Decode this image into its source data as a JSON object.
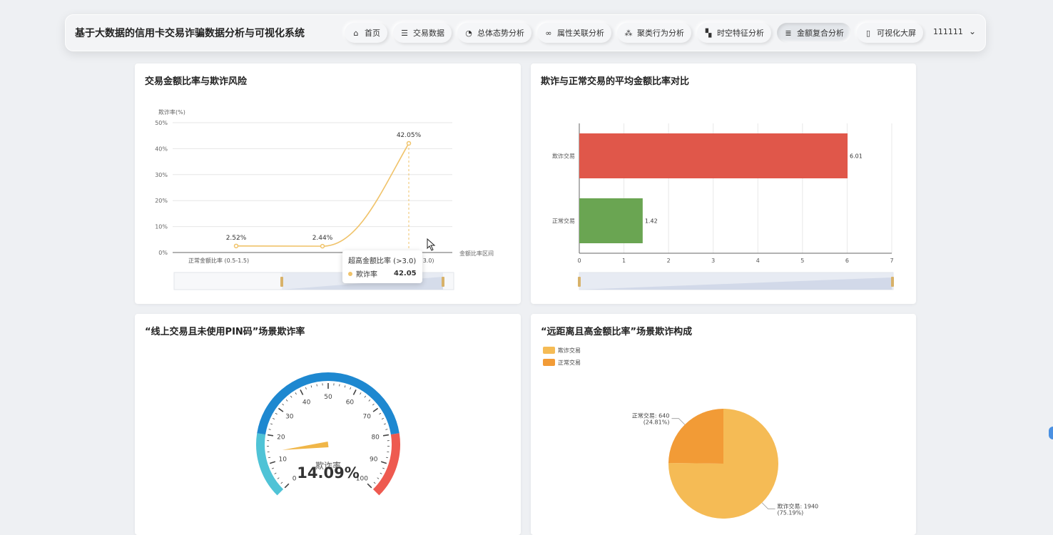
{
  "header": {
    "title": "基于大数据的信用卡交易诈骗数据分析与可视化系统",
    "nav": [
      {
        "label": "首页",
        "icon": "home-icon",
        "glyph": "⌂"
      },
      {
        "label": "交易数据",
        "icon": "database-icon",
        "glyph": "☰"
      },
      {
        "label": "总体态势分析",
        "icon": "pie-chart-icon",
        "glyph": "◔"
      },
      {
        "label": "属性关联分析",
        "icon": "link-icon",
        "glyph": "∞"
      },
      {
        "label": "聚类行为分析",
        "icon": "cluster-icon",
        "glyph": "⁂"
      },
      {
        "label": "时空特征分析",
        "icon": "map-icon",
        "glyph": "▚"
      },
      {
        "label": "金额复合分析",
        "icon": "coins-icon",
        "glyph": "≣"
      },
      {
        "label": "可视化大屏",
        "icon": "screen-icon",
        "glyph": "▯"
      }
    ],
    "active_nav": 6,
    "user": "111111",
    "user_caret": "⌄"
  },
  "panels": {
    "line": {
      "title": "交易金额比率与欺诈风险"
    },
    "bar": {
      "title": "欺诈与正常交易的平均金额比率对比"
    },
    "gauge": {
      "title": "“线上交易且未使用PIN码”场景欺诈率"
    },
    "pie": {
      "title": "“远距离且高金额比率”场景欺诈构成"
    }
  },
  "tooltip": {
    "title": "超高金额比率 (>3.0)",
    "series": "欺诈率",
    "value": "42.05"
  },
  "chart_data": [
    {
      "type": "line",
      "title": "交易金额比率与欺诈风险",
      "xlabel": "金额比率区间",
      "ylabel": "欺诈率(%)",
      "ylim": [
        0,
        50
      ],
      "yticks": [
        "0%",
        "10%",
        "20%",
        "30%",
        "40%",
        "50%"
      ],
      "categories": [
        "正常金额比率 (0.5-1.5)",
        "",
        "超高金额比率 (>3.0)"
      ],
      "visible_tick_labels": [
        "正常金额比率 (0.5-1.5)",
        ">3.0)"
      ],
      "series": [
        {
          "name": "欺诈率",
          "values": [
            2.52,
            2.44,
            42.05
          ],
          "labels": [
            "2.52%",
            "2.44%",
            "42.05%"
          ]
        }
      ],
      "color": "#f0c36a",
      "grid": true,
      "has_datazoom": true
    },
    {
      "type": "bar",
      "title": "欺诈与正常交易的平均金额比率对比",
      "orientation": "horizontal",
      "categories": [
        "欺诈交易",
        "正常交易"
      ],
      "values": [
        6.01,
        1.42
      ],
      "colors": [
        "#e0574a",
        "#6aa552"
      ],
      "xlim": [
        0,
        7
      ],
      "xticks": [
        "0",
        "1",
        "2",
        "3",
        "4",
        "5",
        "6",
        "7"
      ],
      "grid": true,
      "has_datazoom": true
    },
    {
      "type": "gauge",
      "title": "“线上交易且未使用PIN码”场景欺诈率",
      "min": 0,
      "max": 100,
      "value": 14.09,
      "value_label": "14.09%",
      "name": "欺诈率",
      "tick_labels": [
        "0",
        "10",
        "20",
        "30",
        "40",
        "50",
        "60",
        "70",
        "80",
        "90",
        "100"
      ],
      "bands": [
        {
          "to": 0.2,
          "color": "#4fc3d6"
        },
        {
          "to": 0.8,
          "color": "#1e88d0"
        },
        {
          "to": 1.0,
          "color": "#ee5a50"
        }
      ]
    },
    {
      "type": "pie",
      "title": "“远距离且高金额比率”场景欺诈构成",
      "legend": [
        "欺诈交易",
        "正常交易"
      ],
      "legend_position": "top-left",
      "slices": [
        {
          "name": "欺诈交易",
          "value": 1940,
          "percent": "75.19%",
          "label": "欺诈交易: 1940",
          "sublabel": "(75.19%)",
          "color": "#f5bb55"
        },
        {
          "name": "正常交易",
          "value": 640,
          "percent": "24.81%",
          "label": "正常交易: 640",
          "sublabel": "(24.81%)",
          "color": "#f29b36"
        }
      ]
    }
  ]
}
